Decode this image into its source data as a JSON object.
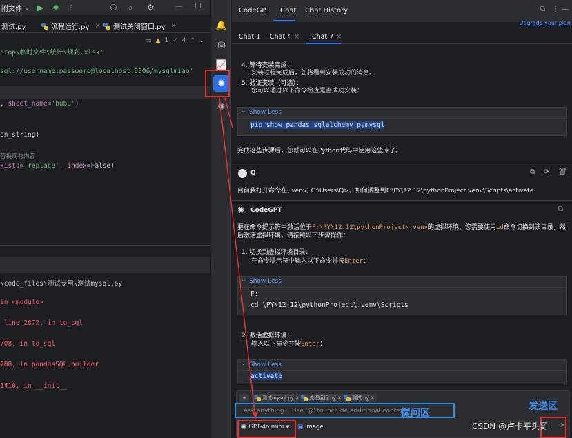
{
  "ide": {
    "menu_label": "附文件",
    "tabs": [
      {
        "label": "测试.py"
      },
      {
        "label": "流程运行.py"
      },
      {
        "label": "测试关闭窗口.py"
      }
    ],
    "editor_info": {
      "warnings": "1",
      "checks": "4"
    },
    "code_lines": [
      {
        "text": "ctop\\临时文件\\统计\\规划.xlsx'",
        "cls": "c-str"
      },
      {
        "text": "sql://username:password@localhost:3306/mysqlmiao'",
        "cls": "c-str"
      },
      {
        "text": ", sheet_name='bubu')",
        "cls": "c-plain"
      },
      {
        "text": "on_string)",
        "cls": "c-plain"
      },
      {
        "text": "替换现有内容",
        "cls": "c-com"
      },
      {
        "text": "xists='replace', index=False)",
        "cls": "c-plain"
      }
    ],
    "run_lines": [
      {
        "text": "\\code_files\\测试专用\\测试mysql.py",
        "cls": "c-plain"
      },
      {
        "text": "in <module>",
        "cls": "c-err"
      },
      {
        "text": " line 2872, in to_sql",
        "cls": "c-err"
      },
      {
        "text": "708, in to_sql",
        "cls": "c-err"
      },
      {
        "text": "788, in pandasSQL_builder",
        "cls": "c-err"
      },
      {
        "text": "1410, in __init__",
        "cls": "c-err"
      }
    ]
  },
  "panel": {
    "title": "CodeGPT",
    "tab_chat": "Chat",
    "tab_history": "Chat History",
    "upgrade_link": "Upgrade your plan",
    "chat_tabs": [
      "Chat 1",
      "Chat 4",
      "Chat 7"
    ],
    "messages": {
      "step4_title": "4.  等待安装完成：",
      "step4_body": "安装过程完成后，您将看到安装成功的消息。",
      "step5_title": "5.  验证安装（可选）：",
      "step5_body": "您可以通过以下命令检查是否成功安装：",
      "show_less": "Show Less",
      "code1": "pip show pandas sqlalchemy pymysql",
      "after_code1": "完成这些步骤后，您就可以在Python代码中使用这些库了。",
      "user_name": "Q",
      "user_question": "目前我打开命令在(.venv) C:\\Users\\Q>，如何调整到F:\\PY\\12.12\\pythonProject.venv\\Scripts\\activate",
      "bot_name": "CodeGPT",
      "answer_intro_a": "要在命令提示符中激活位于",
      "answer_intro_path": "F:\\PY\\12.12\\pythonProject\\.venv",
      "answer_intro_b": "的虚拟环境，您需要使用",
      "answer_intro_cd": "cd",
      "answer_intro_c": "命令切换到该目录，然",
      "answer_intro_line2": "后激活虚拟环境。请按照以下步骤操作：",
      "step1_title": "1.  切换到虚拟环境目录：",
      "step1_body_a": "在命令提示符中输入以下命令并按",
      "step1_body_key": "Enter",
      "step1_body_b": "：",
      "code2_line1": "F:",
      "code2_line2": "cd \\PY\\12.12\\pythonProject\\.venv\\Scripts",
      "step2_title": "2.  激活虚拟环境：",
      "step2_body_a": "输入以下命令并按",
      "step2_body_key": "Enter",
      "step2_body_b": "：",
      "code3": "activate"
    },
    "context_chips": [
      "测试mysql.py",
      "流程运行.py",
      "测试.py"
    ],
    "input_placeholder": "Ask anything... Use '@' to include additional context",
    "model_label": "GPT-4o mini",
    "image_label": "Image"
  },
  "annotations": {
    "input_zone_label": "提问区",
    "send_zone_label": "发送区"
  },
  "watermark": "CSDN @卢卡平头哥"
}
